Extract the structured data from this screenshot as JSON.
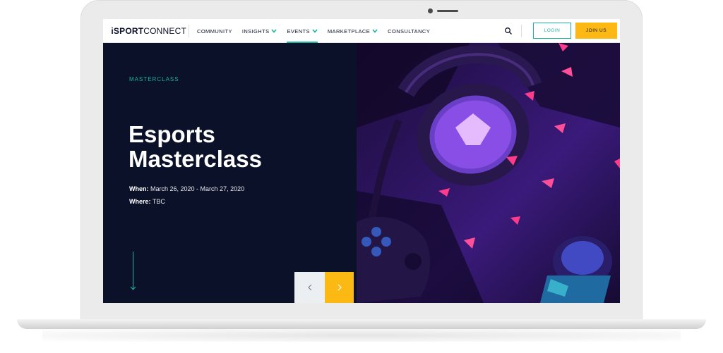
{
  "brand": {
    "logo_prefix": "iSPORT",
    "logo_suffix": "CONNECT",
    "accent_color": "#19b3a2",
    "cta_color": "#fdb913",
    "navy_color": "#0b1128"
  },
  "nav": {
    "items": [
      {
        "label": "COMMUNITY",
        "has_dropdown": false,
        "active": false
      },
      {
        "label": "INSIGHTS",
        "has_dropdown": true,
        "active": false
      },
      {
        "label": "EVENTS",
        "has_dropdown": true,
        "active": true
      },
      {
        "label": "MARKETPLACE",
        "has_dropdown": true,
        "active": false
      },
      {
        "label": "CONSULTANCY",
        "has_dropdown": false,
        "active": false
      }
    ],
    "search_icon": "search-icon",
    "login_label": "LOGIN",
    "join_label": "JOIN US"
  },
  "hero": {
    "eyebrow": "MASTERCLASS",
    "title": "Esports Masterclass",
    "when_label": "When:",
    "when_value": "March 26, 2020 - March 27, 2020",
    "where_label": "Where:",
    "where_value": "TBC",
    "scroll_icon": "arrow-down-icon",
    "prev_icon": "chevron-left-icon",
    "next_icon": "chevron-right-icon",
    "image_icon": "gaming-headset-controller-photo"
  }
}
